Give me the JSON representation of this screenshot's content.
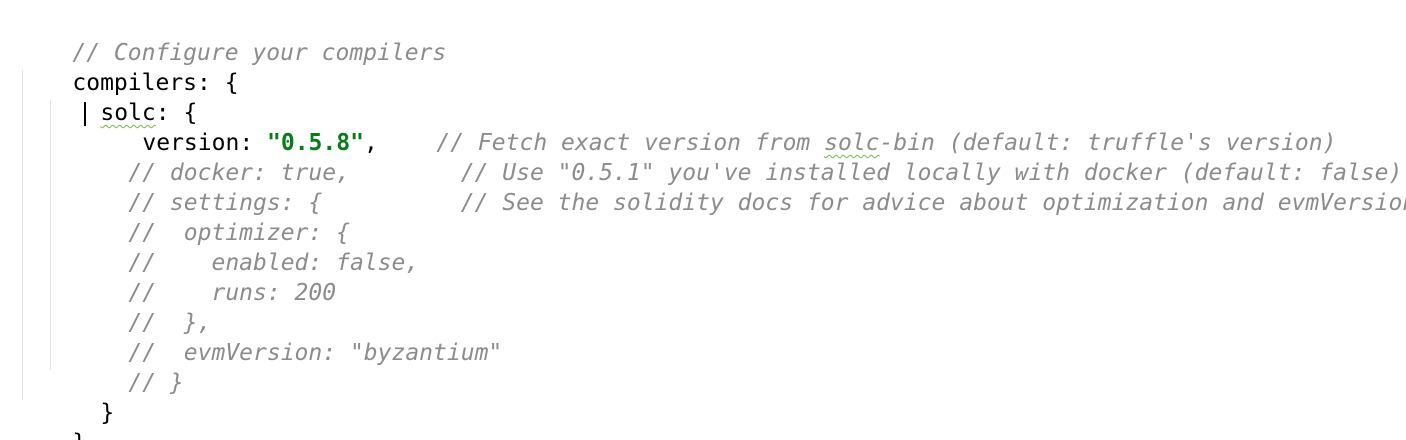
{
  "editor": {
    "lines": [
      {
        "comment": "// Configure your compilers"
      },
      {
        "code": "compilers: {"
      },
      {
        "key": "solc",
        "rest": ": {"
      },
      {
        "code": "version: ",
        "string": "\"0.5.8\"",
        "after": ",",
        "comment_a": "// Fetch exact version from ",
        "comment_word": "solc",
        "comment_b": "-bin (default: truffle's version)"
      },
      {
        "comment": "// docker: true,        // Use \"0.5.1\" you've installed locally with docker (default: false)"
      },
      {
        "comment": "// settings: {          // See the solidity docs for advice about optimization and evmVersion"
      },
      {
        "comment": "//  optimizer: {"
      },
      {
        "comment": "//    enabled: false,"
      },
      {
        "comment": "//    runs: 200"
      },
      {
        "comment": "//  },"
      },
      {
        "comment": "//  evmVersion: \"byzantium\""
      },
      {
        "comment": "// }"
      },
      {
        "code": "}"
      },
      {
        "code": "}"
      }
    ]
  }
}
